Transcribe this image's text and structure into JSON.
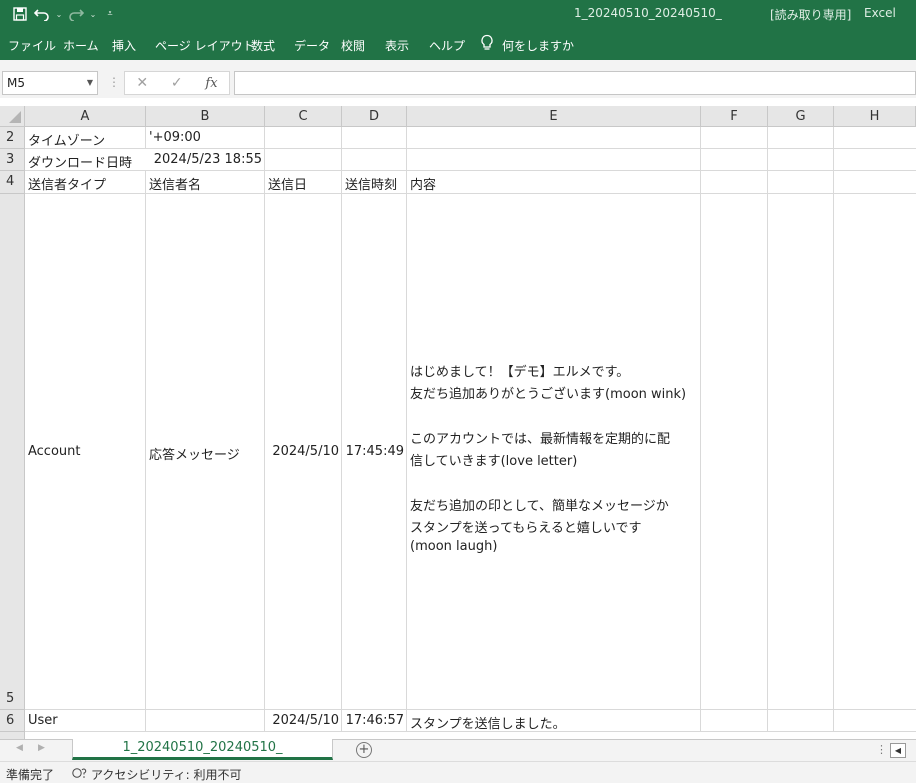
{
  "titlebar": {
    "filename": "1_20240510_20240510_",
    "mode": "[読み取り専用]",
    "app": "Excel",
    "icons": [
      "save-icon",
      "undo-icon",
      "redo-icon",
      "customize-qat-icon"
    ]
  },
  "ribbon": {
    "tabs": [
      "ファイル",
      "ホーム",
      "挿入",
      "ページ レイアウト",
      "数式",
      "データ",
      "校閲",
      "表示",
      "ヘルプ"
    ],
    "tellme": "何をしますか"
  },
  "formula_bar": {
    "name_box": "M5",
    "fx": "fx",
    "value": ""
  },
  "columns": [
    "A",
    "B",
    "C",
    "D",
    "E",
    "F",
    "G",
    "H"
  ],
  "rows": [
    {
      "num": "2",
      "A": "タイムゾーン",
      "B": "'+09:00",
      "C": "",
      "D": ""
    },
    {
      "num": "3",
      "A": "ダウンロード日時",
      "B": "2024/5/23 18:55",
      "C": "",
      "D": ""
    },
    {
      "num": "4",
      "A": "送信者タイプ",
      "B": "送信者名",
      "C": "送信日",
      "D": "送信時刻",
      "E": "内容"
    },
    {
      "num": "5",
      "A": "Account",
      "B": "応答メッセージ",
      "C": "2024/5/10",
      "D": "17:45:49",
      "E_lines": [
        "はじめまして！【デモ】エルメです。",
        "友だち追加ありがとうございます(moon wink)",
        "",
        "このアカウントでは、最新情報を定期的に配",
        "信していきます(love letter)",
        "",
        "友だち追加の印として、簡単なメッセージか",
        "スタンプを送ってもらえると嬉しいです",
        "(moon laugh)"
      ]
    },
    {
      "num": "6",
      "A": "User",
      "B": "",
      "C": "2024/5/10",
      "D": "17:46:57",
      "E": "スタンプを送信しました。"
    }
  ],
  "sheet_tabs": {
    "active": "1_20240510_20240510_"
  },
  "statusbar": {
    "ready": "準備完了",
    "accessibility": "アクセシビリティ: 利用不可"
  },
  "colors": {
    "excel_green": "#217346",
    "header_gray": "#e6e6e6",
    "gridline": "#d9d9d9"
  }
}
